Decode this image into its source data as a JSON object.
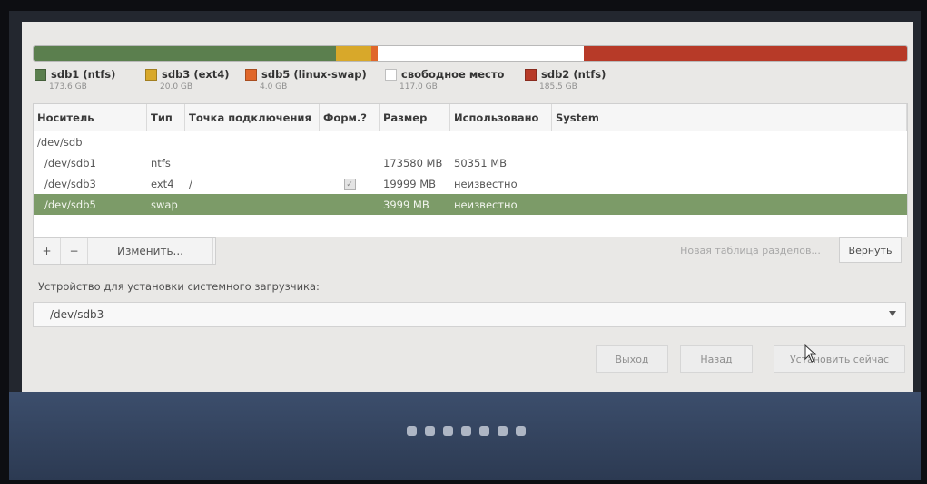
{
  "partition_bar": {
    "segments": [
      {
        "name": "sdb1",
        "color": "#5b7f4e",
        "fraction": 0.3464
      },
      {
        "name": "sdb3",
        "color": "#d8a82a",
        "fraction": 0.0399
      },
      {
        "name": "sdb5",
        "color": "#e0672a",
        "fraction": 0.008
      },
      {
        "name": "free",
        "color": "#ffffff",
        "fraction": 0.2355
      },
      {
        "name": "sdb2",
        "color": "#b73a28",
        "fraction": 0.3702
      }
    ]
  },
  "legend": [
    {
      "label": "sdb1 (ntfs)",
      "size": "173.6 GB",
      "color": "#5b7f4e"
    },
    {
      "label": "sdb3 (ext4)",
      "size": "20.0 GB",
      "color": "#d8a82a"
    },
    {
      "label": "sdb5 (linux-swap)",
      "size": "4.0 GB",
      "color": "#e0672a"
    },
    {
      "label": "свободное место",
      "size": "117.0 GB",
      "color": "#ffffff"
    },
    {
      "label": "sdb2 (ntfs)",
      "size": "185.5 GB",
      "color": "#b73a28"
    }
  ],
  "table": {
    "headers": [
      "Носитель",
      "Тип",
      "Точка подключения",
      "Форм.?",
      "Размер",
      "Использовано",
      "System"
    ],
    "rows": [
      {
        "device": "/dev/sdb",
        "type": "",
        "mount": "",
        "format": false,
        "size": "",
        "used": "",
        "system": ""
      },
      {
        "device": "/dev/sdb1",
        "type": "ntfs",
        "mount": "",
        "format": false,
        "size": "173580 MB",
        "used": "50351 MB",
        "system": ""
      },
      {
        "device": "/dev/sdb3",
        "type": "ext4",
        "mount": "/",
        "format": true,
        "size": "19999 MB",
        "used": "неизвестно",
        "system": ""
      },
      {
        "device": "/dev/sdb5",
        "type": "swap",
        "mount": "",
        "format": false,
        "size": "3999 MB",
        "used": "неизвестно",
        "system": "",
        "selected": true
      }
    ]
  },
  "toolbar": {
    "add": "+",
    "remove": "−",
    "change": "Изменить..."
  },
  "new_partition_table": "Новая таблица разделов...",
  "revert": "Вернуть",
  "bootloader": {
    "label": "Устройство для установки системного загрузчика:",
    "value": "/dev/sdb3"
  },
  "footer": {
    "quit": "Выход",
    "back": "Назад",
    "install": "Установить сейчас"
  },
  "progress_dots": 7
}
